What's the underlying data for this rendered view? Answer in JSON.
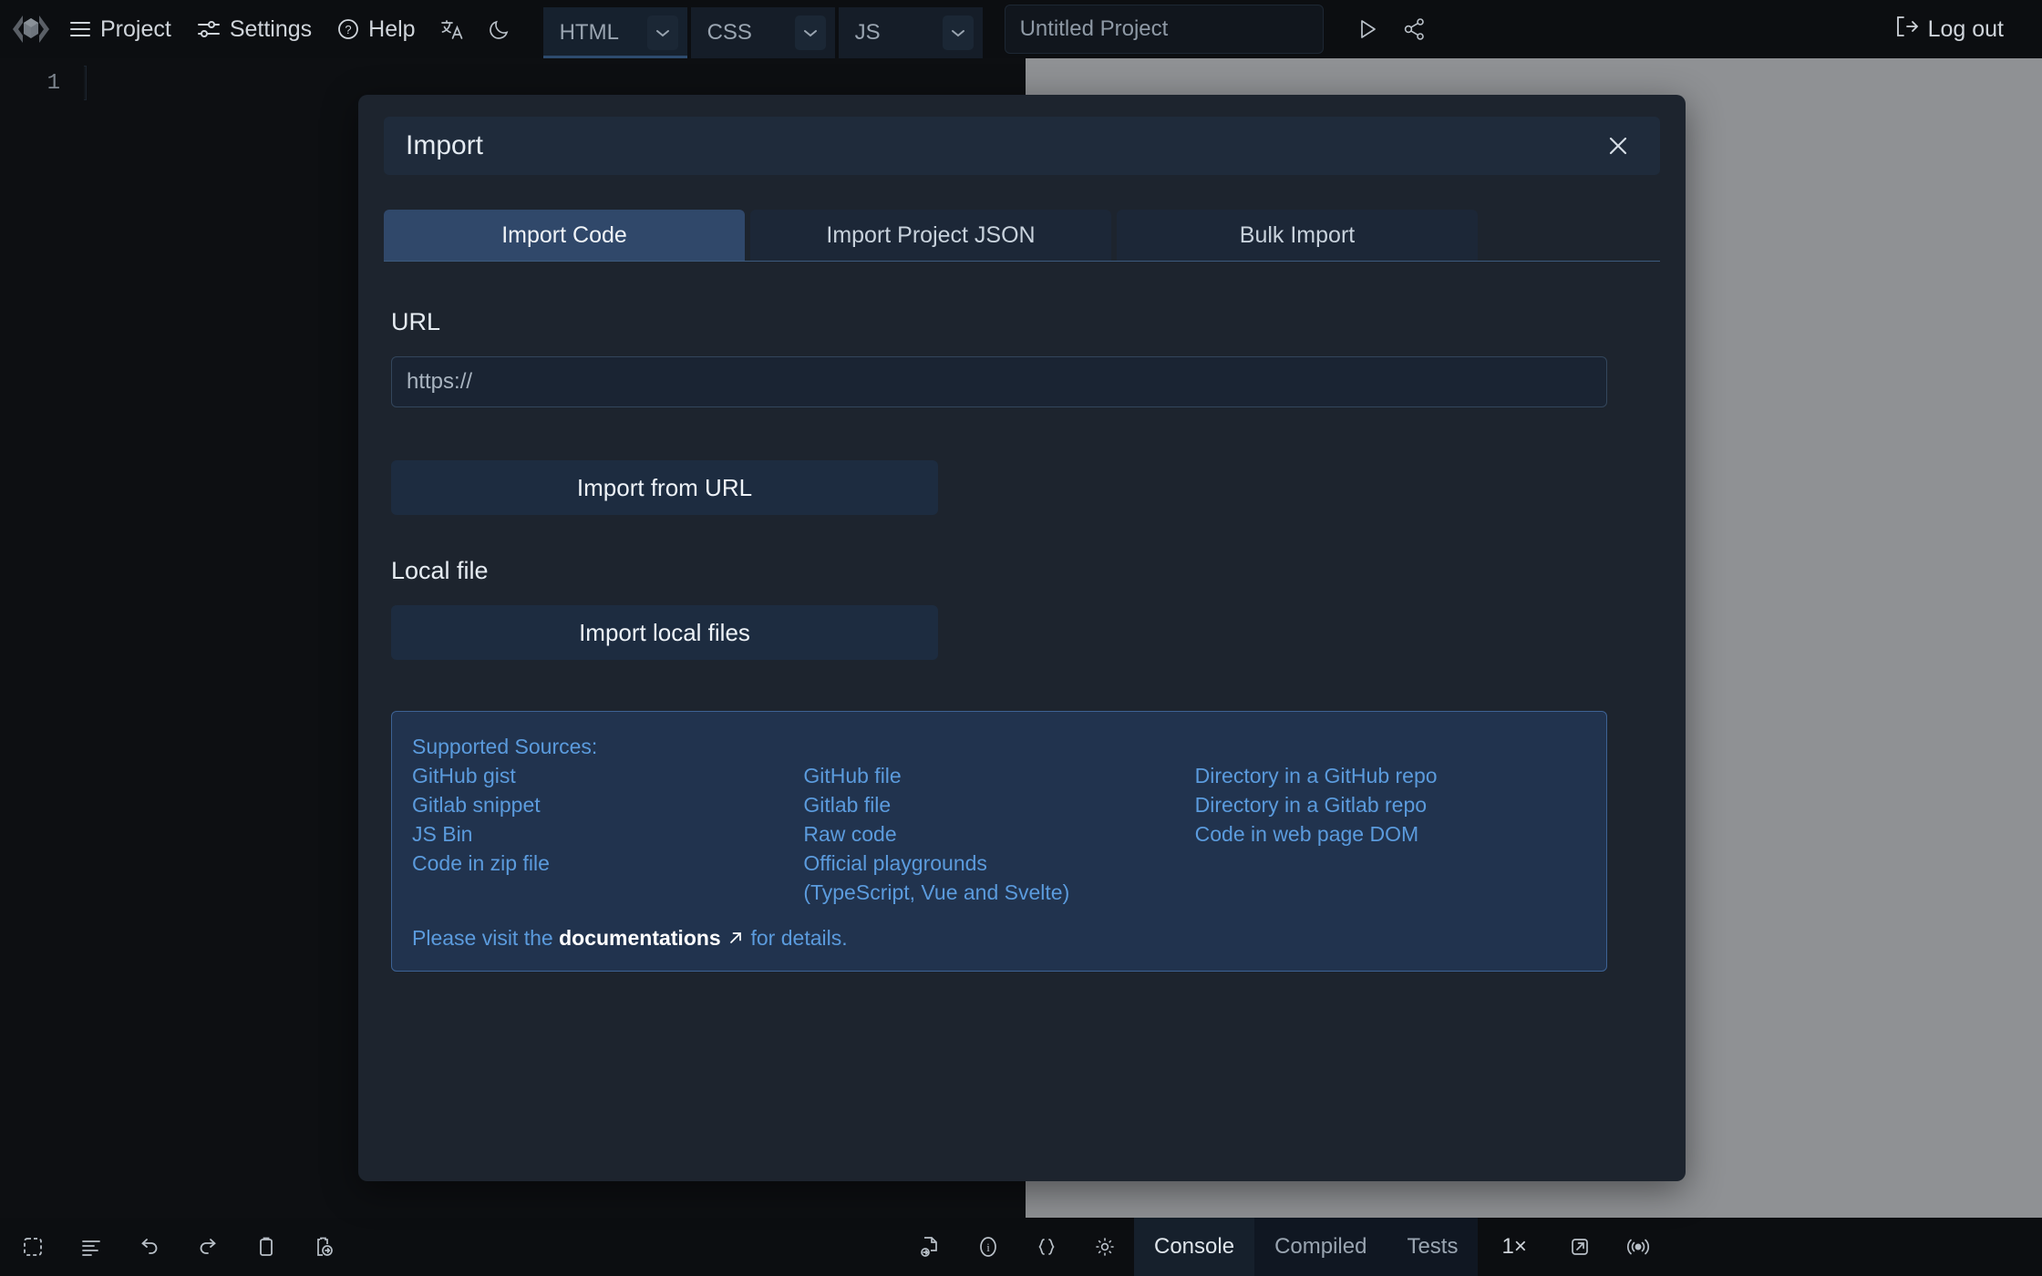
{
  "topbar": {
    "logo_name": "code-cube-logo",
    "menus": [
      {
        "label": "Project",
        "icon": "hamburger-icon"
      },
      {
        "label": "Settings",
        "icon": "sliders-icon"
      },
      {
        "label": "Help",
        "icon": "question-circle-icon"
      }
    ],
    "translate_icon": "translate-icon",
    "theme_icon": "moon-icon",
    "languages": [
      {
        "label": "HTML",
        "active": true
      },
      {
        "label": "CSS",
        "active": false
      },
      {
        "label": "JS",
        "active": false
      }
    ],
    "project_title": "Untitled Project",
    "run_icon": "play-icon",
    "share_icon": "share-icon",
    "logout_label": "Log out",
    "logout_icon": "logout-icon"
  },
  "editor": {
    "line_number": "1"
  },
  "modal": {
    "title": "Import",
    "close_icon": "close-icon",
    "tabs": [
      {
        "label": "Import Code",
        "active": true
      },
      {
        "label": "Import Project JSON",
        "active": false
      },
      {
        "label": "Bulk Import",
        "active": false
      }
    ],
    "url_label": "URL",
    "url_placeholder": "https://",
    "url_value": "",
    "import_url_button": "Import from URL",
    "local_file_label": "Local file",
    "import_local_button": "Import local files",
    "sources": {
      "heading": "Supported Sources:",
      "col1": [
        "GitHub gist",
        "Gitlab snippet",
        "JS Bin",
        "Code in zip file"
      ],
      "col2": [
        "GitHub file",
        "Gitlab file",
        "Raw code",
        "Official playgrounds",
        "(TypeScript, Vue and Svelte)"
      ],
      "col3": [
        "Directory in a GitHub repo",
        "Directory in a Gitlab repo",
        "Code in web page DOM"
      ],
      "footer_prefix": "Please visit the ",
      "footer_link": "documentations",
      "footer_link_icon": "external-link-arrow",
      "footer_suffix": " for details."
    }
  },
  "bottombar": {
    "left_icons": [
      "select-all-icon",
      "format-code-icon",
      "undo-icon",
      "redo-icon",
      "copy-icon",
      "paste-icon"
    ],
    "mid_icons": [
      "file-link-icon",
      "info-icon",
      "braces-icon",
      "gear-icon"
    ],
    "tabs": [
      {
        "label": "Console",
        "active": true
      },
      {
        "label": "Compiled",
        "active": false
      },
      {
        "label": "Tests",
        "active": false
      }
    ],
    "zoom_label": "1×",
    "open_external_icon": "open-in-new-icon",
    "broadcast_icon": "broadcast-icon"
  },
  "colors": {
    "accent": "#30486a",
    "link": "#5b9bdd",
    "panel": "#1d242e",
    "preview_bg": "#8f9194"
  }
}
